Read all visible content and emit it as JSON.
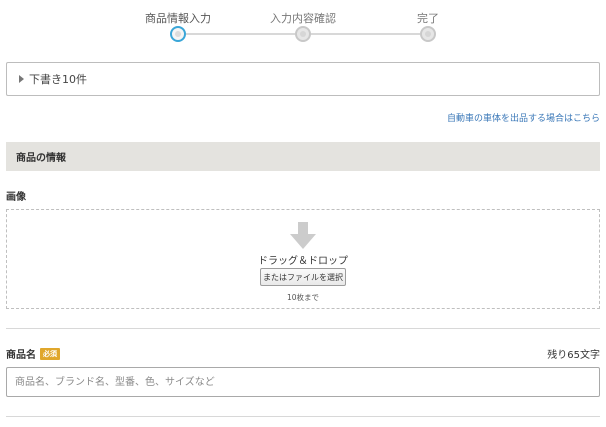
{
  "stepper": {
    "steps": [
      {
        "label": "商品情報入力",
        "active": true
      },
      {
        "label": "入力内容確認",
        "active": false
      },
      {
        "label": "完了",
        "active": false
      }
    ],
    "accent_color": "#3aa6d8"
  },
  "drafts": {
    "label": "下書き10件",
    "icon": "caret-right-icon"
  },
  "car_link": "自動車の車体を出品する場合はこちら",
  "section": {
    "title": "商品の情報"
  },
  "image_upload": {
    "heading": "画像",
    "icon": "download-arrow-icon",
    "drop_text": "ドラッグ＆ドロップ",
    "select_button": "またはファイルを選択",
    "limit_text": "10枚まで"
  },
  "product_name": {
    "label": "商品名",
    "required_badge": "必須",
    "remaining": "残り65文字",
    "placeholder": "商品名、ブランド名、型番、色、サイズなど",
    "value": "",
    "badge_color": "#e0a72c"
  }
}
